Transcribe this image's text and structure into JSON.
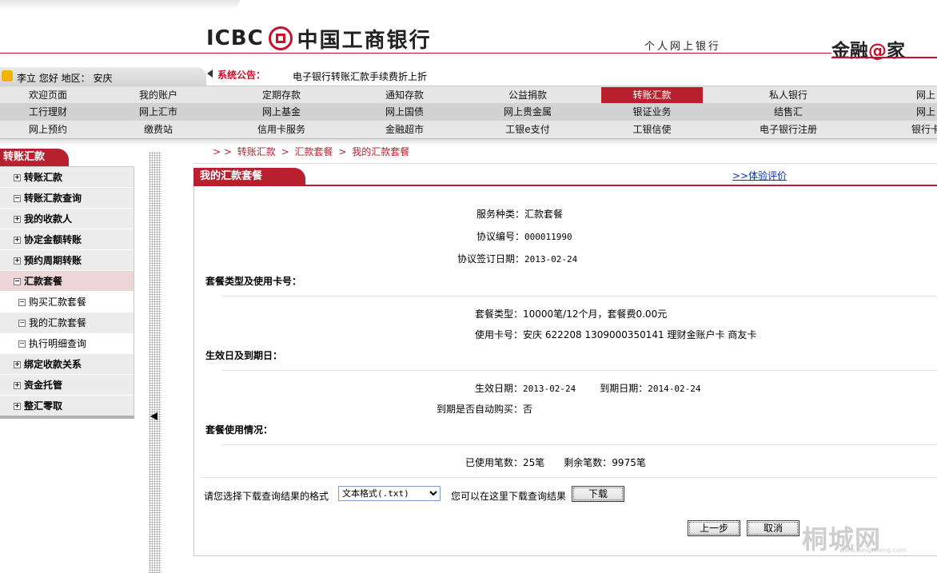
{
  "header": {
    "logo_en": "ICBC",
    "logo_cn": "中国工商银行",
    "subtitle": "个人网上银行",
    "brand_pre": "金融",
    "brand_at": "@",
    "brand_post": "家"
  },
  "user": {
    "text": "李立  您好  地区：  安庆"
  },
  "notice": {
    "label": "系统公告：",
    "text": "电子银行转账汇款手续费折上折"
  },
  "nav": {
    "row1": [
      "欢迎页面",
      "我的账户",
      "定期存款",
      "通知存款",
      "公益捐款",
      "转账汇款",
      "私人银行",
      "网上"
    ],
    "row2": [
      "工行理财",
      "网上汇市",
      "网上基金",
      "网上国债",
      "网上贵金属",
      "银证业务",
      "结售汇",
      "网上"
    ],
    "row3": [
      "网上预约",
      "缴费站",
      "信用卡服务",
      "金融超市",
      "工银e支付",
      "工银信使",
      "电子银行注册",
      "银行卡"
    ],
    "active": "转账汇款"
  },
  "sidebar": {
    "title": "转账汇款",
    "items": [
      {
        "label": "转账汇款",
        "pm": "+"
      },
      {
        "label": "转账汇款查询",
        "pm": "−"
      },
      {
        "label": "我的收款人",
        "pm": "+"
      },
      {
        "label": "协定金额转账",
        "pm": "+"
      },
      {
        "label": "预约周期转账",
        "pm": "+"
      },
      {
        "label": "汇款套餐",
        "pm": "−"
      },
      {
        "label": "绑定收款关系",
        "pm": "+"
      },
      {
        "label": "资金托管",
        "pm": "+"
      },
      {
        "label": "整汇零取",
        "pm": "+"
      }
    ],
    "subitems": [
      {
        "label": "购买汇款套餐",
        "pm": "−"
      },
      {
        "label": "我的汇款套餐",
        "pm": "−"
      },
      {
        "label": "执行明细查询",
        "pm": "−"
      }
    ]
  },
  "breadcrumb": {
    "prefix": "> >",
    "items": [
      "转账汇款",
      "汇款套餐",
      "我的汇款套餐"
    ],
    "sep": ">"
  },
  "panel": {
    "title": "我的汇款套餐",
    "eval_link": ">>体验评价",
    "service_type_label": "服务种类：",
    "service_type": "汇款套餐",
    "agreement_no_label": "协议编号：",
    "agreement_no": "000011990",
    "sign_date_label": "协议签订日期：",
    "sign_date": "2013-02-24",
    "sec1": "套餐类型及使用卡号：",
    "pkg_type_label": "套餐类型：",
    "pkg_type": "10000笔/12个月，套餐费0.00元",
    "card_label": "使用卡号：",
    "card": "安庆  622208  1309000350141  理财金账户卡  商友卡",
    "sec2": "生效日及到期日：",
    "eff_label": "生效日期：",
    "eff_date": "2013-02-24",
    "exp_label": "到期日期：",
    "exp_date": "2014-02-24",
    "auto_label": "到期是否自动购买：",
    "auto": "否",
    "sec3": "套餐使用情况：",
    "used_label": "已使用笔数：",
    "used": "25笔",
    "remain_label": "剩余笔数：",
    "remain": "9975笔",
    "download_prompt": "请您选择下载查询结果的格式",
    "format_selected": "文本格式(.txt)",
    "download_hint": "您可以在这里下载查询结果",
    "download_btn": "下载",
    "prev_btn": "上一步",
    "cancel_btn": "取消"
  },
  "watermark": {
    "text": "桐城网",
    "sub": "www.tongcheng.com"
  }
}
